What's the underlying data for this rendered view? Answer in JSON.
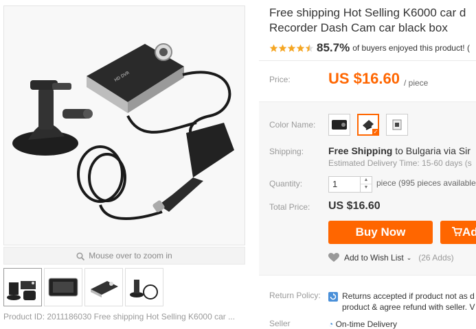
{
  "product": {
    "title_line1": "Free shipping Hot Selling K6000 car d",
    "title_line2": "Recorder Dash Cam car black box",
    "rating_percent": "85.7%",
    "rating_text": "of buyers enjoyed this product! (",
    "stars": 4.5
  },
  "price": {
    "label": "Price:",
    "value": "US $16.60",
    "unit": "/ piece"
  },
  "options": {
    "color_label": "Color Name:",
    "selected_index": 1
  },
  "shipping": {
    "label": "Shipping:",
    "free_text": "Free Shipping",
    "destination_text": "to Bulgaria via Sir",
    "delivery_text": "Estimated Delivery Time: 15-60 days (s"
  },
  "quantity": {
    "label": "Quantity:",
    "value": "1",
    "available_text": "piece (995 pieces available"
  },
  "total": {
    "label": "Total Price:",
    "value": "US $16.60"
  },
  "actions": {
    "buy_now": "Buy Now",
    "add_to_cart_partial": "Ad",
    "wish_list": "Add to Wish List",
    "wish_count": "(26 Adds)"
  },
  "policy": {
    "return_label": "Return Policy:",
    "return_line1": "Returns accepted if product not as d",
    "return_line2": "product & agree refund with seller. V",
    "seller_label": "Seller",
    "ontime": "On-time Delivery"
  },
  "gallery": {
    "zoom_hint": "Mouse over to zoom in",
    "product_id_text": "Product ID: 2011186030 Free shipping Hot Selling K6000 car ..."
  },
  "colors": {
    "accent": "#ff6600"
  }
}
